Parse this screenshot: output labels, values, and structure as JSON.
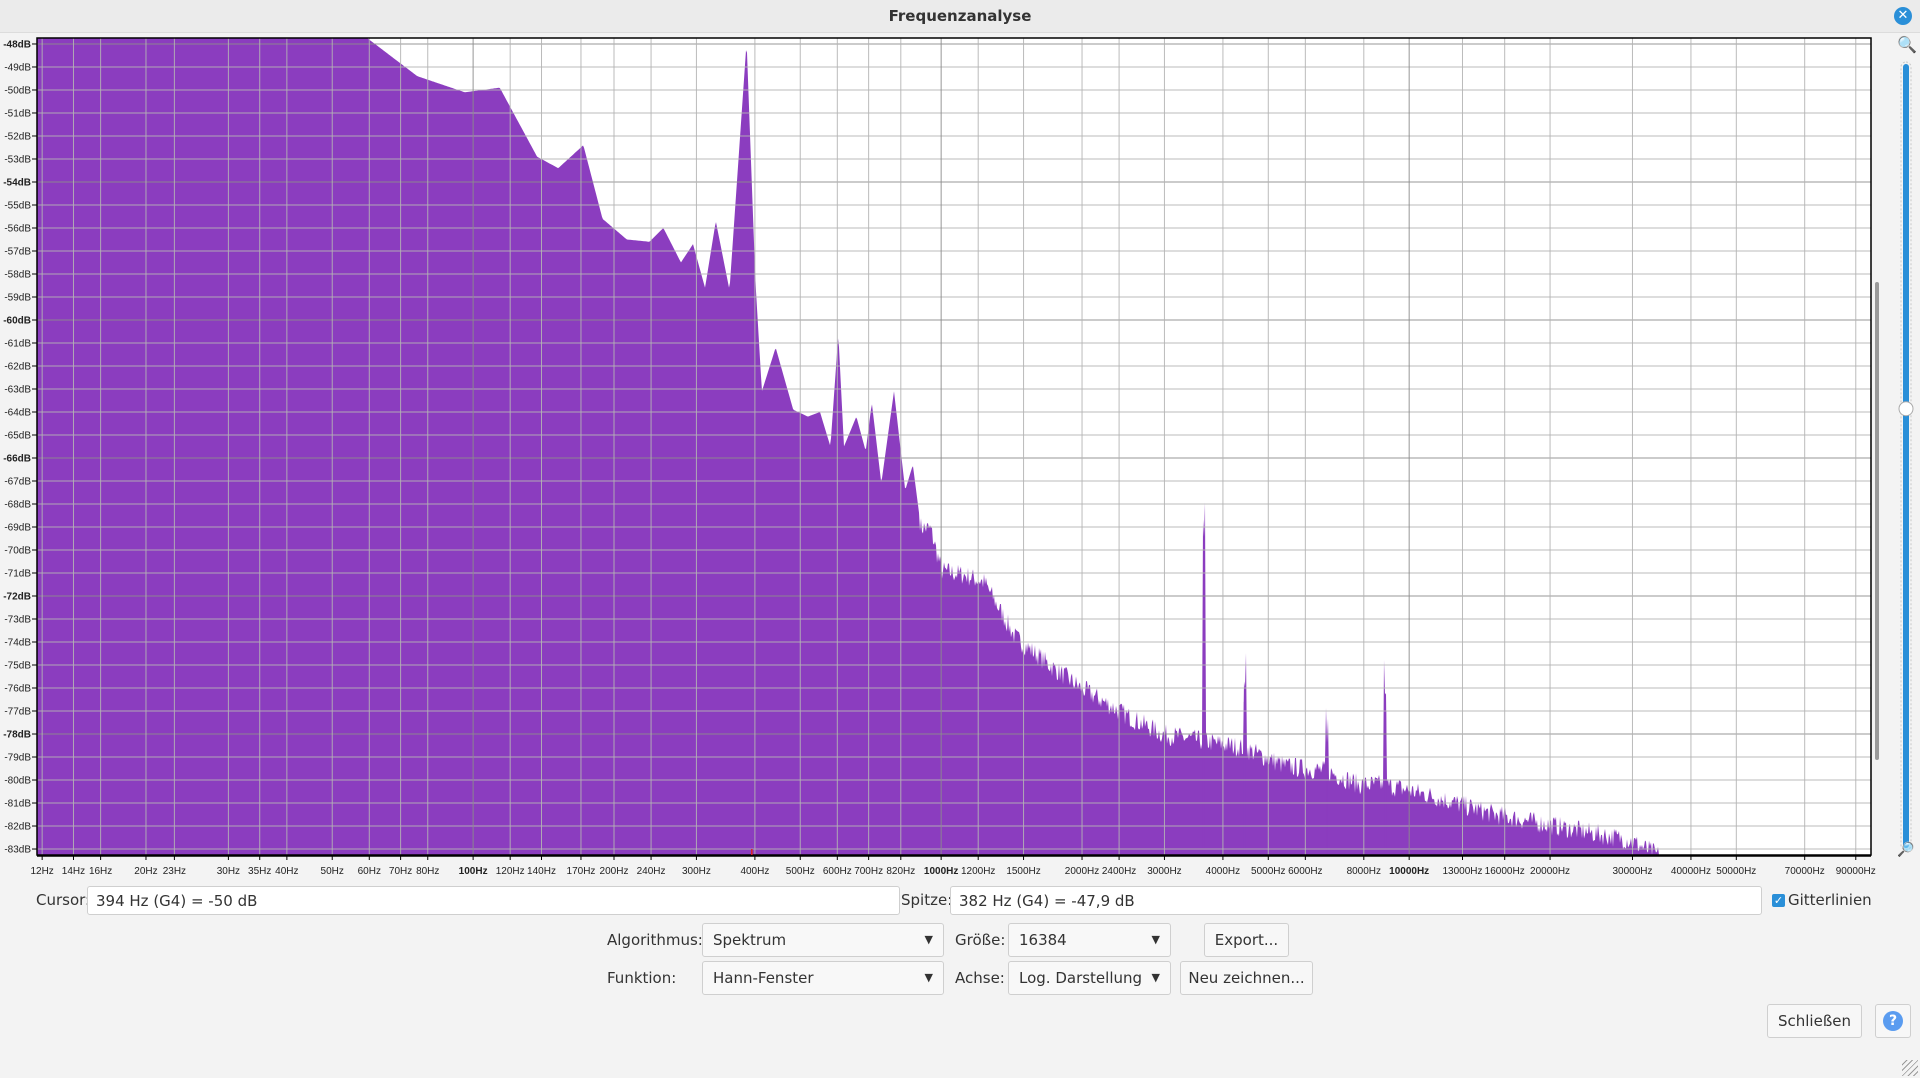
{
  "window": {
    "title": "Frequenzanalyse"
  },
  "colors": {
    "spectrum_fill": "#8b3dbf",
    "cursor_line": "#e02020",
    "accent": "#2a8fd8"
  },
  "chart_data": {
    "type": "area",
    "title": "Frequenzanalyse",
    "xscale": "log",
    "xlim": [
      11.7,
      97000
    ],
    "ylim": [
      -83.26,
      -47.74
    ],
    "grid": true,
    "x_ticks": [
      {
        "v": 12,
        "label": "12Hz"
      },
      {
        "v": 14,
        "label": "14Hz"
      },
      {
        "v": 16,
        "label": "16Hz"
      },
      {
        "v": 20,
        "label": "20Hz"
      },
      {
        "v": 23,
        "label": "23Hz"
      },
      {
        "v": 30,
        "label": "30Hz"
      },
      {
        "v": 35,
        "label": "35Hz"
      },
      {
        "v": 40,
        "label": "40Hz"
      },
      {
        "v": 50,
        "label": "50Hz"
      },
      {
        "v": 60,
        "label": "60Hz"
      },
      {
        "v": 70,
        "label": "70Hz"
      },
      {
        "v": 80,
        "label": "80Hz"
      },
      {
        "v": 100,
        "label": "100Hz",
        "major": true
      },
      {
        "v": 120,
        "label": "120Hz"
      },
      {
        "v": 140,
        "label": "140Hz"
      },
      {
        "v": 170,
        "label": "170Hz"
      },
      {
        "v": 200,
        "label": "200Hz"
      },
      {
        "v": 240,
        "label": "240Hz"
      },
      {
        "v": 300,
        "label": "300Hz"
      },
      {
        "v": 400,
        "label": "400Hz"
      },
      {
        "v": 500,
        "label": "500Hz"
      },
      {
        "v": 600,
        "label": "600Hz"
      },
      {
        "v": 700,
        "label": "700Hz"
      },
      {
        "v": 820,
        "label": "820Hz"
      },
      {
        "v": 1000,
        "label": "1000Hz",
        "major": true
      },
      {
        "v": 1200,
        "label": "1200Hz"
      },
      {
        "v": 1500,
        "label": "1500Hz"
      },
      {
        "v": 2000,
        "label": "2000Hz"
      },
      {
        "v": 2400,
        "label": "2400Hz"
      },
      {
        "v": 3000,
        "label": "3000Hz"
      },
      {
        "v": 4000,
        "label": "4000Hz"
      },
      {
        "v": 5000,
        "label": "5000Hz"
      },
      {
        "v": 6000,
        "label": "6000Hz"
      },
      {
        "v": 8000,
        "label": "8000Hz"
      },
      {
        "v": 10000,
        "label": "10000Hz",
        "major": true
      },
      {
        "v": 13000,
        "label": "13000Hz"
      },
      {
        "v": 16000,
        "label": "16000Hz"
      },
      {
        "v": 20000,
        "label": "20000Hz"
      },
      {
        "v": 30000,
        "label": "30000Hz"
      },
      {
        "v": 40000,
        "label": "40000Hz"
      },
      {
        "v": 50000,
        "label": "50000Hz"
      },
      {
        "v": 70000,
        "label": "70000Hz"
      },
      {
        "v": 90000,
        "label": "90000Hz"
      }
    ],
    "y_ticks": [
      {
        "v": -48,
        "label": "-48dB",
        "major": true
      },
      {
        "v": -49,
        "label": "-49dB"
      },
      {
        "v": -50,
        "label": "-50dB"
      },
      {
        "v": -51,
        "label": "-51dB"
      },
      {
        "v": -52,
        "label": "-52dB"
      },
      {
        "v": -53,
        "label": "-53dB"
      },
      {
        "v": -54,
        "label": "-54dB",
        "major": true
      },
      {
        "v": -55,
        "label": "-55dB"
      },
      {
        "v": -56,
        "label": "-56dB"
      },
      {
        "v": -57,
        "label": "-57dB"
      },
      {
        "v": -58,
        "label": "-58dB"
      },
      {
        "v": -59,
        "label": "-59dB"
      },
      {
        "v": -60,
        "label": "-60dB",
        "major": true
      },
      {
        "v": -61,
        "label": "-61dB"
      },
      {
        "v": -62,
        "label": "-62dB"
      },
      {
        "v": -63,
        "label": "-63dB"
      },
      {
        "v": -64,
        "label": "-64dB"
      },
      {
        "v": -65,
        "label": "-65dB"
      },
      {
        "v": -66,
        "label": "-66dB",
        "major": true
      },
      {
        "v": -67,
        "label": "-67dB"
      },
      {
        "v": -68,
        "label": "-68dB"
      },
      {
        "v": -69,
        "label": "-69dB"
      },
      {
        "v": -70,
        "label": "-70dB"
      },
      {
        "v": -71,
        "label": "-71dB"
      },
      {
        "v": -72,
        "label": "-72dB",
        "major": true
      },
      {
        "v": -73,
        "label": "-73dB"
      },
      {
        "v": -74,
        "label": "-74dB"
      },
      {
        "v": -75,
        "label": "-75dB"
      },
      {
        "v": -76,
        "label": "-76dB"
      },
      {
        "v": -77,
        "label": "-77dB"
      },
      {
        "v": -78,
        "label": "-78dB",
        "major": true
      },
      {
        "v": -79,
        "label": "-79dB"
      },
      {
        "v": -80,
        "label": "-80dB"
      },
      {
        "v": -81,
        "label": "-81dB"
      },
      {
        "v": -82,
        "label": "-82dB"
      },
      {
        "v": -83,
        "label": "-83dB"
      }
    ],
    "spectrum": [
      [
        11.7,
        -47
      ],
      [
        59,
        -47.7
      ],
      [
        76,
        -49.4
      ],
      [
        96,
        -50.1
      ],
      [
        114,
        -49.9
      ],
      [
        137,
        -52.9
      ],
      [
        152,
        -53.4
      ],
      [
        172,
        -52.4
      ],
      [
        189,
        -55.6
      ],
      [
        213,
        -56.5
      ],
      [
        238,
        -56.6
      ],
      [
        255,
        -56
      ],
      [
        278,
        -57.5
      ],
      [
        295,
        -56.7
      ],
      [
        313,
        -58.6
      ],
      [
        330,
        -55.7
      ],
      [
        353,
        -58.7
      ],
      [
        384,
        -47.9
      ],
      [
        401,
        -58.3
      ],
      [
        414,
        -63.1
      ],
      [
        443,
        -61.2
      ],
      [
        483,
        -63.9
      ],
      [
        519,
        -64.2
      ],
      [
        551,
        -64
      ],
      [
        580,
        -65.5
      ],
      [
        603,
        -60.6
      ],
      [
        620,
        -65.5
      ],
      [
        659,
        -64.2
      ],
      [
        690,
        -65.7
      ],
      [
        711,
        -63.6
      ],
      [
        745,
        -67.1
      ],
      [
        793,
        -63.1
      ],
      [
        838,
        -67.4
      ],
      [
        870,
        -66.3
      ],
      [
        905,
        -69
      ],
      [
        950,
        -69.1
      ],
      [
        1002,
        -70.9
      ],
      [
        1128,
        -71.1
      ],
      [
        1237,
        -71.4
      ],
      [
        1440,
        -73.8
      ],
      [
        1730,
        -75.1
      ],
      [
        1990,
        -76
      ],
      [
        2490,
        -77.2
      ],
      [
        2970,
        -78
      ],
      [
        3620,
        -78.3
      ],
      [
        4430,
        -78.6
      ],
      [
        5450,
        -79.4
      ],
      [
        6660,
        -79.6
      ],
      [
        7830,
        -80.2
      ],
      [
        8900,
        -80.2
      ],
      [
        11200,
        -80.7
      ],
      [
        15200,
        -81.5
      ],
      [
        20500,
        -82
      ],
      [
        29400,
        -82.6
      ],
      [
        34300,
        -83.3
      ],
      [
        36000,
        -90
      ]
    ],
    "spikes": [
      [
        3640,
        -69.8
      ],
      [
        4450,
        -76.6
      ],
      [
        6680,
        -78.6
      ],
      [
        8900,
        -77
      ]
    ],
    "cursor_freq": 394
  },
  "readouts": {
    "cursor_label": "Cursor:",
    "cursor_value": "394 Hz (G4) = -50 dB",
    "peak_label": "Spitze:",
    "peak_value": "382 Hz (G4) = -47,9 dB",
    "grid_label": "Gitterlinien",
    "grid_checked": true
  },
  "controls": {
    "algorithm_label": "Algorithmus:",
    "algorithm_value": "Spektrum",
    "size_label": "Größe:",
    "size_value": "16384",
    "export_label": "Export...",
    "function_label": "Funktion:",
    "function_value": "Hann-Fenster",
    "axis_label": "Achse:",
    "axis_value": "Log. Darstellung",
    "redraw_label": "Neu zeichnen...",
    "close_label": "Schließen",
    "help_label": "?"
  },
  "zoom": {
    "level": 0.56
  }
}
